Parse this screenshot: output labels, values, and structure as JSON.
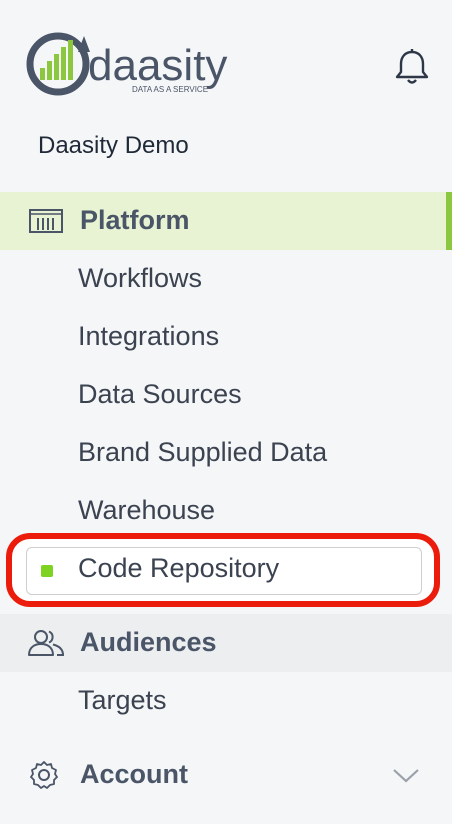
{
  "brand": {
    "logo_word": "daasity",
    "tagline": "DATA AS A SERVICE",
    "accent_color": "#8dc63f",
    "highlight_color": "#ec1c0c"
  },
  "header": {
    "bell_icon": "bell-icon",
    "org_name": "Daasity Demo"
  },
  "nav": {
    "platform": {
      "label": "Platform",
      "icon": "warehouse-icon",
      "items": [
        "Workflows",
        "Integrations",
        "Data Sources",
        "Brand Supplied Data",
        "Warehouse",
        "Code Repository"
      ],
      "active_item": "Code Repository"
    },
    "audiences": {
      "label": "Audiences",
      "icon": "users-icon",
      "items": [
        "Targets"
      ]
    },
    "account": {
      "label": "Account",
      "icon": "gear-icon",
      "expand_icon": "chevron-down-icon"
    }
  }
}
